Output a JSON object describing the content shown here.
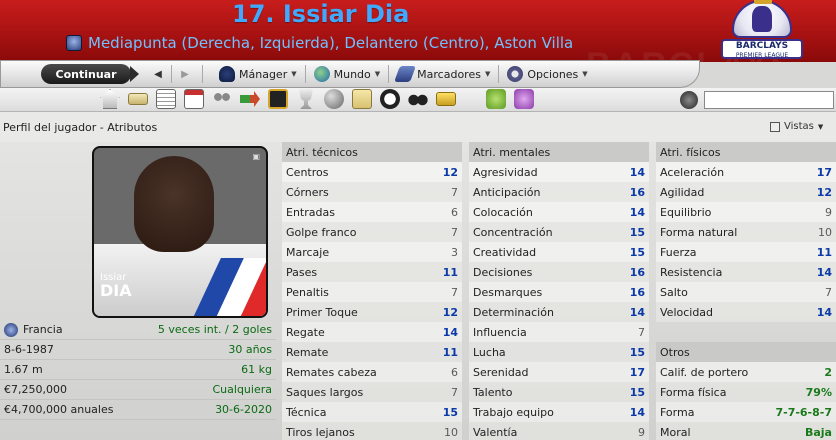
{
  "header": {
    "player_title": "17. Issiar Dia",
    "subtitle": "Mediapunta (Derecha, Izquierda), Delantero (Centro), Aston Villa",
    "league_logo_text": "BARCLAYS",
    "league_logo_small": "PREMIER LEAGUE"
  },
  "toolbar": {
    "continue_label": "Continuar",
    "back_icon": "arrow-left-icon",
    "forward_icon": "arrow-right-icon",
    "menus": [
      {
        "label": "Mánager",
        "icon": "manager-icon"
      },
      {
        "label": "Mundo",
        "icon": "globe-icon"
      },
      {
        "label": "Marcadores",
        "icon": "bookmark-icon"
      },
      {
        "label": "Opciones",
        "icon": "gear-icon"
      }
    ]
  },
  "subheader": {
    "title": "Perfil del jugador - Atributos",
    "views_label": "Vistas"
  },
  "photo": {
    "first_name": "Issiar",
    "last_name": "DIA"
  },
  "bio": [
    {
      "key": "Francia",
      "value": "5 veces int. / 2 goles"
    },
    {
      "key": "8-6-1987",
      "value": "30 años"
    },
    {
      "key": "1.67 m",
      "value": "61 kg"
    },
    {
      "key": "€7,250,000",
      "value": "Cualquiera"
    },
    {
      "key": "€4,700,000 anuales",
      "value": "30-6-2020"
    }
  ],
  "columns": {
    "technical": {
      "title": "Atri. técnicos",
      "rows": [
        {
          "name": "Centros",
          "value": "12",
          "color": "blue"
        },
        {
          "name": "Córners",
          "value": "7",
          "color": "grey"
        },
        {
          "name": "Entradas",
          "value": "6",
          "color": "grey"
        },
        {
          "name": "Golpe franco",
          "value": "7",
          "color": "grey"
        },
        {
          "name": "Marcaje",
          "value": "3",
          "color": "grey"
        },
        {
          "name": "Pases",
          "value": "11",
          "color": "blue"
        },
        {
          "name": "Penaltis",
          "value": "7",
          "color": "grey"
        },
        {
          "name": "Primer Toque",
          "value": "12",
          "color": "blue"
        },
        {
          "name": "Regate",
          "value": "14",
          "color": "blue"
        },
        {
          "name": "Remate",
          "value": "11",
          "color": "blue"
        },
        {
          "name": "Remates cabeza",
          "value": "6",
          "color": "grey"
        },
        {
          "name": "Saques largos",
          "value": "7",
          "color": "grey"
        },
        {
          "name": "Técnica",
          "value": "15",
          "color": "blue"
        },
        {
          "name": "Tiros lejanos",
          "value": "10",
          "color": "grey"
        }
      ]
    },
    "mental": {
      "title": "Atri. mentales",
      "rows": [
        {
          "name": "Agresividad",
          "value": "14",
          "color": "blue"
        },
        {
          "name": "Anticipación",
          "value": "16",
          "color": "blue"
        },
        {
          "name": "Colocación",
          "value": "14",
          "color": "blue"
        },
        {
          "name": "Concentración",
          "value": "15",
          "color": "blue"
        },
        {
          "name": "Creatividad",
          "value": "15",
          "color": "blue"
        },
        {
          "name": "Decisiones",
          "value": "16",
          "color": "blue"
        },
        {
          "name": "Desmarques",
          "value": "16",
          "color": "blue"
        },
        {
          "name": "Determinación",
          "value": "14",
          "color": "blue"
        },
        {
          "name": "Influencia",
          "value": "7",
          "color": "grey"
        },
        {
          "name": "Lucha",
          "value": "15",
          "color": "blue"
        },
        {
          "name": "Serenidad",
          "value": "17",
          "color": "blue"
        },
        {
          "name": "Talento",
          "value": "15",
          "color": "blue"
        },
        {
          "name": "Trabajo equipo",
          "value": "14",
          "color": "blue"
        },
        {
          "name": "Valentía",
          "value": "9",
          "color": "grey"
        }
      ]
    },
    "physical": {
      "title": "Atri. físicos",
      "rows": [
        {
          "name": "Aceleración",
          "value": "17",
          "color": "blue"
        },
        {
          "name": "Agilidad",
          "value": "12",
          "color": "blue"
        },
        {
          "name": "Equilibrio",
          "value": "9",
          "color": "grey"
        },
        {
          "name": "Forma natural",
          "value": "10",
          "color": "grey"
        },
        {
          "name": "Fuerza",
          "value": "11",
          "color": "blue"
        },
        {
          "name": "Resistencia",
          "value": "14",
          "color": "blue"
        },
        {
          "name": "Salto",
          "value": "7",
          "color": "grey"
        },
        {
          "name": "Velocidad",
          "value": "14",
          "color": "blue"
        }
      ]
    },
    "others": {
      "title": "Otros",
      "rows": [
        {
          "name": "Calif. de portero",
          "value": "2",
          "color": "green"
        },
        {
          "name": "Forma física",
          "value": "79%",
          "color": "green"
        },
        {
          "name": "Forma",
          "value": "7-7-6-8-7",
          "color": "green"
        },
        {
          "name": "Moral",
          "value": "Baja",
          "color": "green"
        }
      ]
    }
  }
}
